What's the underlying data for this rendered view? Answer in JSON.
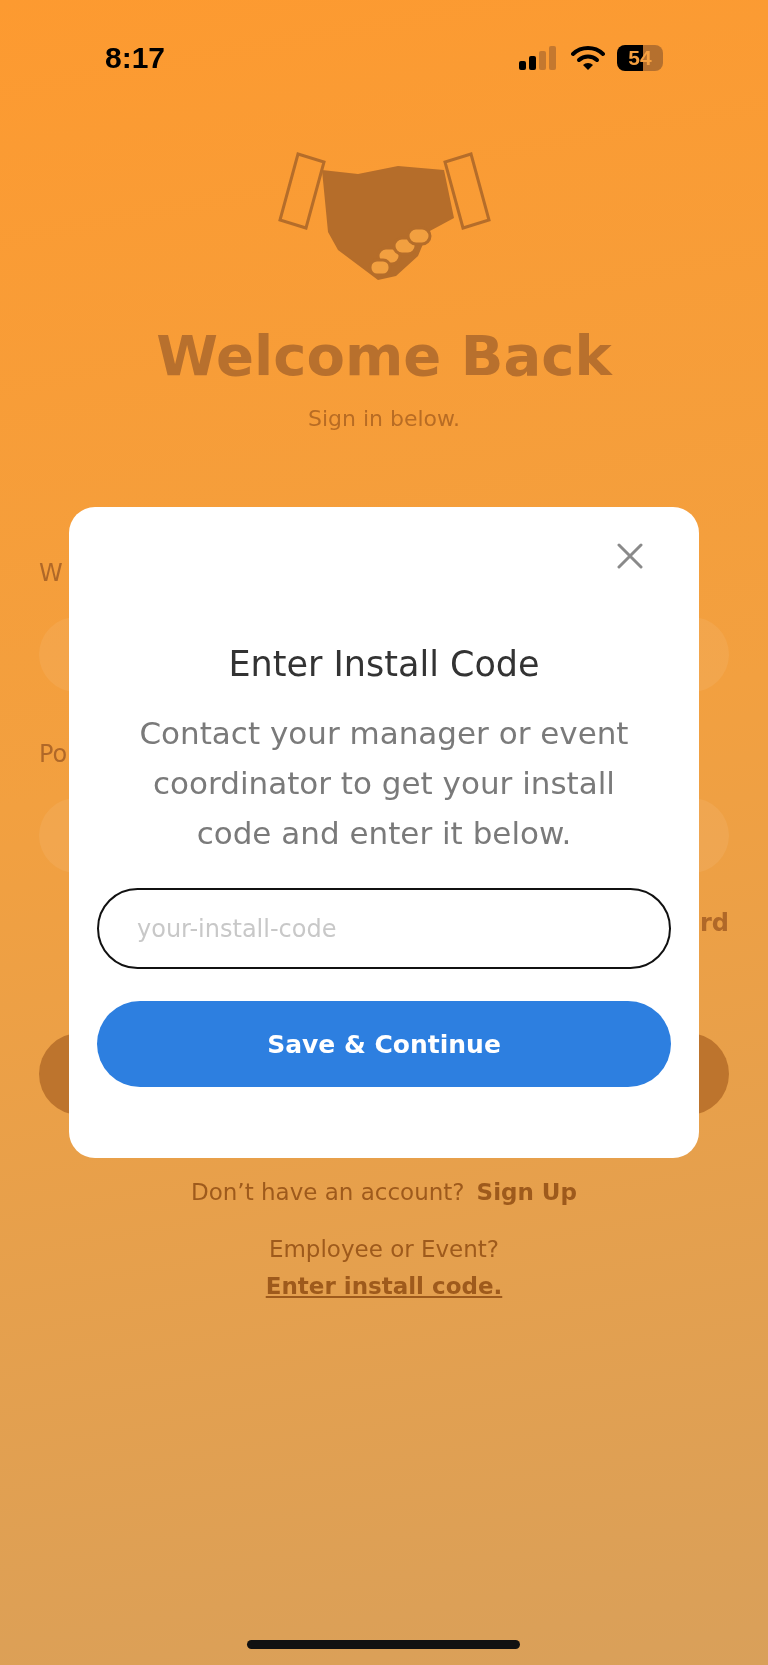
{
  "status_bar": {
    "time": "8:17",
    "battery": "54"
  },
  "header": {
    "title": "Welcome Back",
    "subtitle": "Sign in below."
  },
  "form": {
    "fields": [
      {
        "label": "W"
      },
      {
        "label": "Po"
      }
    ],
    "link": "rd"
  },
  "footer": {
    "signup_prompt": "Don’t have an account?",
    "signup_link": "Sign Up",
    "install_prompt": "Employee or Event?",
    "install_link": "Enter install code."
  },
  "modal": {
    "title": "Enter Install Code",
    "message": "Contact your manager or event coordinator to get your install code and enter it below.",
    "input": {
      "placeholder": "your-install-code"
    },
    "button": "Save & Continue"
  }
}
